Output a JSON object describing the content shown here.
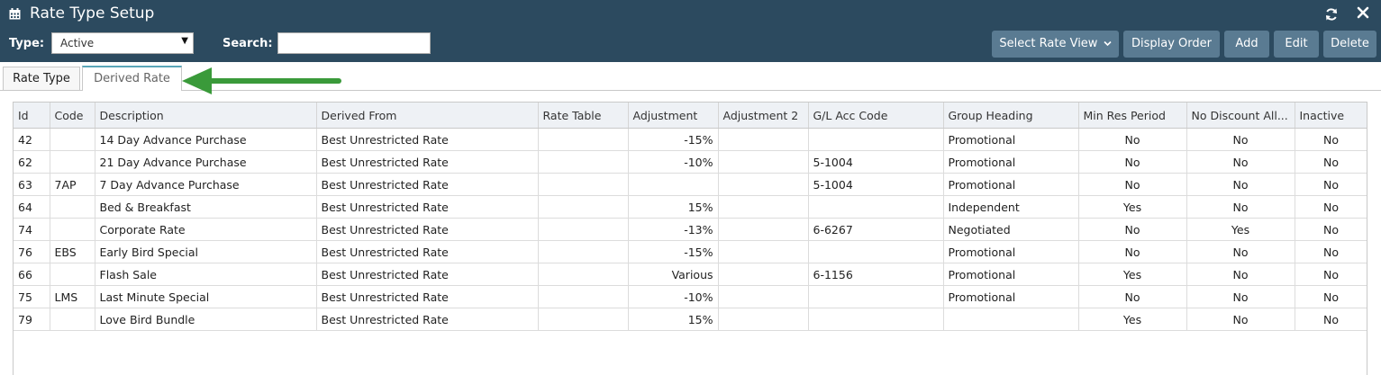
{
  "window": {
    "title": "Rate Type Setup"
  },
  "toolbar": {
    "type_label": "Type:",
    "type_value": "Active",
    "search_label": "Search:",
    "search_value": "",
    "buttons": {
      "select_view": "Select Rate View",
      "display_order": "Display Order",
      "add": "Add",
      "edit": "Edit",
      "delete": "Delete"
    }
  },
  "tabs": [
    {
      "label": "Rate Type",
      "active": false
    },
    {
      "label": "Derived Rate",
      "active": true
    }
  ],
  "colors": {
    "header_bg": "#2c4a5f",
    "button_bg": "#5a7b92",
    "arrow": "#3a9a3a",
    "active_tab_top": "#5aa6b8"
  },
  "table": {
    "columns": [
      "Id",
      "Code",
      "Description",
      "Derived From",
      "Rate Table",
      "Adjustment",
      "Adjustment 2",
      "G/L Acc Code",
      "Group Heading",
      "Min Res Period",
      "No Discount All...",
      "Inactive"
    ],
    "rows": [
      [
        "42",
        "",
        "14 Day Advance Purchase",
        "Best Unrestricted Rate",
        "",
        "-15%",
        "",
        "",
        "Promotional",
        "No",
        "No",
        "No"
      ],
      [
        "62",
        "",
        "21 Day Advance Purchase",
        "Best Unrestricted Rate",
        "",
        "-10%",
        "",
        "5-1004",
        "Promotional",
        "No",
        "No",
        "No"
      ],
      [
        "63",
        "7AP",
        "7 Day Advance Purchase",
        "Best Unrestricted Rate",
        "",
        "",
        "",
        "5-1004",
        "Promotional",
        "No",
        "No",
        "No"
      ],
      [
        "64",
        "",
        "Bed & Breakfast",
        "Best Unrestricted Rate",
        "",
        "15%",
        "",
        "",
        "Independent",
        "Yes",
        "No",
        "No"
      ],
      [
        "74",
        "",
        "Corporate Rate",
        "Best Unrestricted Rate",
        "",
        "-13%",
        "",
        "6-6267",
        "Negotiated",
        "No",
        "Yes",
        "No"
      ],
      [
        "76",
        "EBS",
        "Early Bird Special",
        "Best Unrestricted Rate",
        "",
        "-15%",
        "",
        "",
        "Promotional",
        "No",
        "No",
        "No"
      ],
      [
        "66",
        "",
        "Flash Sale",
        "Best Unrestricted Rate",
        "",
        "Various",
        "",
        "6-1156",
        "Promotional",
        "Yes",
        "No",
        "No"
      ],
      [
        "75",
        "LMS",
        "Last Minute Special",
        "Best Unrestricted Rate",
        "",
        "-10%",
        "",
        "",
        "Promotional",
        "No",
        "No",
        "No"
      ],
      [
        "79",
        "",
        "Love Bird Bundle",
        "Best Unrestricted Rate",
        "",
        "15%",
        "",
        "",
        "",
        "Yes",
        "No",
        "No"
      ]
    ]
  }
}
